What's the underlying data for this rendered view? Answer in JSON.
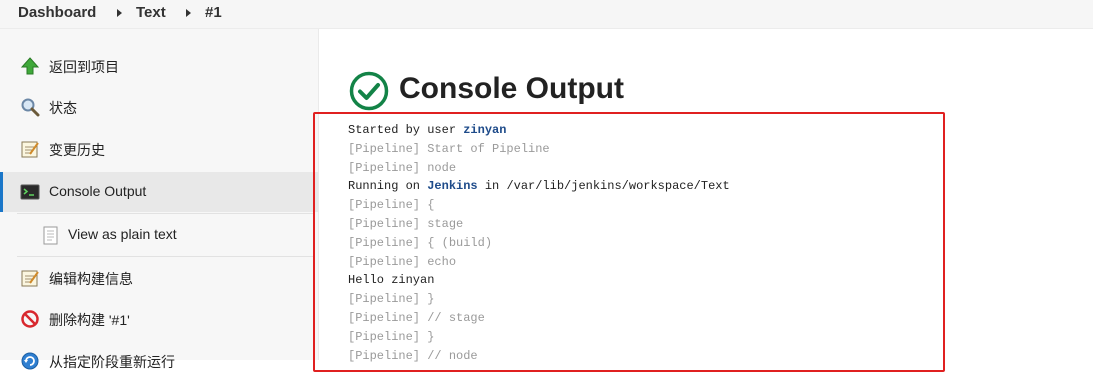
{
  "breadcrumb": {
    "items": [
      "Dashboard",
      "Text",
      "#1"
    ]
  },
  "sidebar": {
    "items": [
      {
        "label": "返回到项目",
        "icon": "up-arrow-icon"
      },
      {
        "label": "状态",
        "icon": "magnifier-icon"
      },
      {
        "label": "变更历史",
        "icon": "notepad-icon"
      },
      {
        "label": "Console Output",
        "icon": "terminal-icon",
        "active": true
      },
      {
        "label": "View as plain text",
        "icon": "document-icon"
      },
      {
        "label": "编辑构建信息",
        "icon": "notepad-icon"
      },
      {
        "label": "删除构建 '#1'",
        "icon": "no-entry-icon"
      },
      {
        "label": "从指定阶段重新运行",
        "icon": "restart-icon"
      }
    ]
  },
  "main": {
    "title": "Console Output",
    "title_icon": "check-circle-icon",
    "status_color": "#138347",
    "highlight_color": "#e02020"
  },
  "console": {
    "line1": {
      "prefix": "Started by user ",
      "user": "zinyan"
    },
    "line2": "[Pipeline] Start of Pipeline",
    "line3": "[Pipeline] node",
    "line4": {
      "prefix": "Running on ",
      "node": "Jenkins",
      "suffix": " in /var/lib/jenkins/workspace/Text"
    },
    "line5": "[Pipeline] {",
    "line6": "[Pipeline] stage",
    "line7": "[Pipeline] { (build)",
    "line8": "[Pipeline] echo",
    "line9": "Hello zinyan",
    "line10": "[Pipeline] }",
    "line11": "[Pipeline] // stage",
    "line12": "[Pipeline] }",
    "line13": "[Pipeline] // node"
  }
}
